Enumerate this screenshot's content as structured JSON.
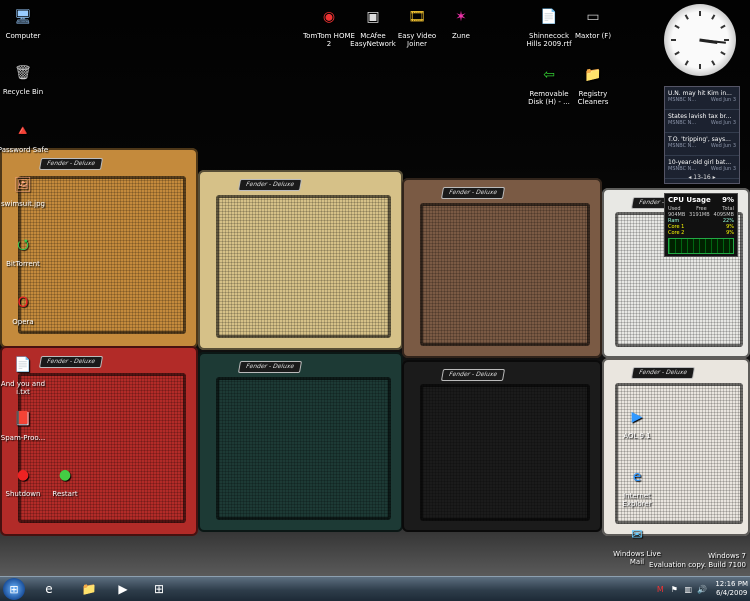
{
  "desktop_icons_left": [
    {
      "name": "computer-icon",
      "label": "Computer",
      "glyph": "🖥"
    },
    {
      "name": "recycle-bin-icon",
      "label": "Recycle Bin",
      "glyph": "🗑"
    },
    {
      "name": "password-safe-icon",
      "label": "Password Safe",
      "glyph": "🔺"
    },
    {
      "name": "swimsuit-jpg-icon",
      "label": "swimsuit.jpg",
      "glyph": "🖼"
    },
    {
      "name": "bittorrent-icon",
      "label": "BitTorrent",
      "glyph": "⭯"
    },
    {
      "name": "opera-icon",
      "label": "Opera",
      "glyph": "O"
    },
    {
      "name": "you-and-i-icon",
      "label": "And you and i.txt",
      "glyph": "📄"
    },
    {
      "name": "spam-proof-icon",
      "label": "Spam-Proo...",
      "glyph": "📕"
    },
    {
      "name": "shutdown-icon",
      "label": "Shutdown",
      "glyph": "●"
    },
    {
      "name": "restart-icon",
      "label": "Restart",
      "glyph": "●"
    }
  ],
  "desktop_icons_top": [
    {
      "name": "tomtom-home-icon",
      "label": "TomTom HOME 2",
      "glyph": "◉"
    },
    {
      "name": "mcafee-easynetwork-icon",
      "label": "McAfee EasyNetwork",
      "glyph": "▣"
    },
    {
      "name": "easy-video-joiner-icon",
      "label": "Easy Video Joiner",
      "glyph": "🎞"
    },
    {
      "name": "zune-icon",
      "label": "Zune",
      "glyph": "✶"
    },
    {
      "name": "shinnecock-hills-icon",
      "label": "Shinnecock Hills 2009.rtf",
      "glyph": "📄"
    },
    {
      "name": "maxtor-icon",
      "label": "Maxtor (F)",
      "glyph": "▭"
    },
    {
      "name": "removable-disk-icon",
      "label": "Removable Disk (H) - ...",
      "glyph": "⇦"
    },
    {
      "name": "registry-cleaners-icon",
      "label": "Registry Cleaners",
      "glyph": "📁"
    }
  ],
  "desktop_icons_right": [
    {
      "name": "aol-icon",
      "label": "AOL 9.1",
      "glyph": "▶"
    },
    {
      "name": "internet-explorer-icon",
      "label": "Internet Explorer",
      "glyph": "e"
    },
    {
      "name": "windows-live-mail-icon",
      "label": "Windows Live Mail",
      "glyph": "✉"
    }
  ],
  "amps": [
    {
      "badge": "Fender - Deluxe",
      "color": "#c48a3c"
    },
    {
      "badge": "Fender - Deluxe",
      "color": "#d6c188"
    },
    {
      "badge": "Fender - Deluxe",
      "color": "#7a5a44"
    },
    {
      "badge": "Fender - Deluxe",
      "color": "#e8e8e4"
    },
    {
      "badge": "Fender - Deluxe",
      "color": "#b22b28"
    },
    {
      "badge": "Fender - Deluxe",
      "color": "#1d3a35"
    },
    {
      "badge": "Fender - Deluxe",
      "color": "#1b1b1b"
    },
    {
      "badge": "Fender - Deluxe",
      "color": "#eae6df"
    }
  ],
  "clock_gadget": {
    "hour": 3,
    "minute": 16
  },
  "news_gadget": {
    "stories": [
      {
        "title": "U.N. may hit Kim in...",
        "source": "MSNBC N...",
        "date": "Wed Jun 3"
      },
      {
        "title": "States lavish tax br...",
        "source": "MSNBC N...",
        "date": "Wed Jun 3"
      },
      {
        "title": "T.O. 'tripping', says...",
        "source": "MSNBC N...",
        "date": "Wed Jun 3"
      },
      {
        "title": "10-year-old girl bat...",
        "source": "MSNBC N...",
        "date": "Wed Jun 3"
      }
    ],
    "pager": "◂  13-16  ▸"
  },
  "cpu_gadget": {
    "title": "CPU Usage",
    "percent": "9%",
    "used_label": "Used",
    "free_label": "Free",
    "total_label": "Total",
    "used": "904MB",
    "free": "3191MB",
    "total": "4095MB",
    "ram_label": "Ram",
    "ram": "22%",
    "core1_label": "Core 1",
    "core1": "9%",
    "core2_label": "Core 2",
    "core2": "9%"
  },
  "watermark": {
    "line1": "Windows 7",
    "line2": "Evaluation copy. Build 7100"
  },
  "taskbar": {
    "start_glyph": "⊞",
    "pinned": [
      {
        "name": "taskbar-ie-icon",
        "glyph": "e"
      },
      {
        "name": "taskbar-explorer-icon",
        "glyph": "📁"
      },
      {
        "name": "taskbar-media-player-icon",
        "glyph": "▶"
      },
      {
        "name": "taskbar-windows-icon",
        "glyph": "⊞"
      }
    ],
    "time": "12:16 PM",
    "date": "6/4/2009"
  }
}
